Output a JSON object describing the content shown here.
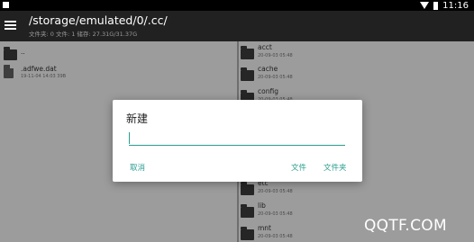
{
  "status_bar": {
    "time": "11:16"
  },
  "app_bar": {
    "path": "/storage/emulated/0/.cc/",
    "info": "文件夹: 0  文件: 1  储存: 27.31G/31.37G"
  },
  "left_pane": {
    "items": [
      {
        "name": "..",
        "meta": "",
        "type": "folder-icon"
      },
      {
        "name": ".adfwe.dat",
        "meta": "19-11-04 14:03  39B",
        "type": "file-icon"
      }
    ]
  },
  "right_pane": {
    "items": [
      {
        "name": "acct",
        "meta": "20-09-03 05:48",
        "type": "folder-icon"
      },
      {
        "name": "cache",
        "meta": "20-09-03 05:48",
        "type": "folder-icon"
      },
      {
        "name": "config",
        "meta": "20-09-03 05:48",
        "type": "folder-icon"
      },
      {
        "name": "etc",
        "meta": "20-09-03 05:48",
        "type": "folder-icon"
      },
      {
        "name": "lib",
        "meta": "20-09-03 05:48",
        "type": "folder-icon"
      },
      {
        "name": "mnt",
        "meta": "20-09-03 05:48",
        "type": "folder-icon"
      }
    ]
  },
  "dialog": {
    "title": "新建",
    "input_value": "",
    "cancel_label": "取消",
    "file_label": "文件",
    "folder_label": "文件夹"
  },
  "watermark": "QQTF.COM",
  "colors": {
    "accent": "#2a9d8f",
    "appbar": "#212121",
    "pane": "#9c9c9c"
  }
}
